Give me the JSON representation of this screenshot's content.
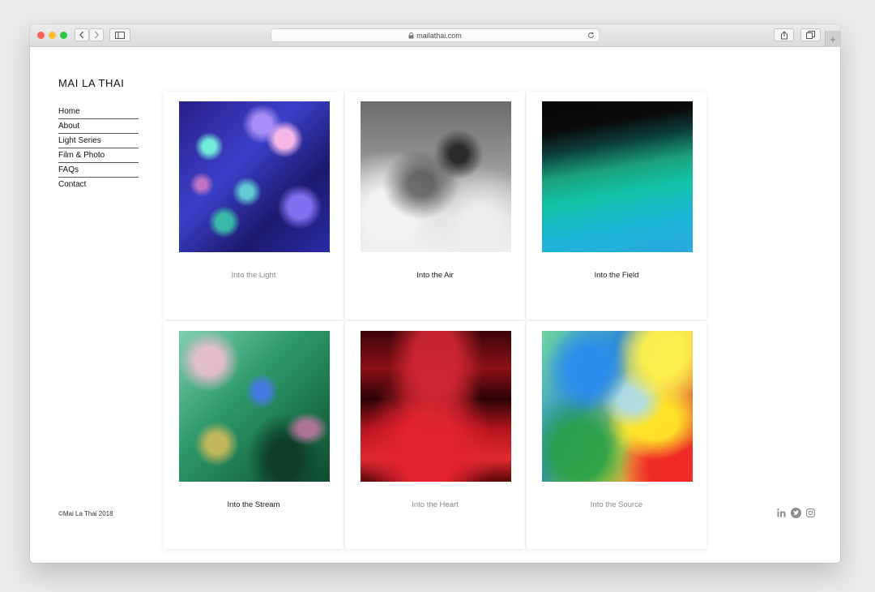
{
  "browser": {
    "url": "mailathai.com",
    "plus_label": "+",
    "lock_glyph": "🔒"
  },
  "site": {
    "title": "MAI LA THAI",
    "copyright": "©Mai La Thai 2018"
  },
  "nav": {
    "items": [
      "Home",
      "About",
      "Light Series",
      "Film & Photo",
      "FAQs",
      "Contact"
    ]
  },
  "gallery": {
    "items": [
      {
        "caption": "Into the Light",
        "image": "blue-purple-bokeh"
      },
      {
        "caption": "Into the Air",
        "image": "grey-smoke-abstract"
      },
      {
        "caption": "Into the Field",
        "image": "green-cyan-gradient"
      },
      {
        "caption": "Into the Stream",
        "image": "green-marble-fluid"
      },
      {
        "caption": "Into the Heart",
        "image": "red-black-blur"
      },
      {
        "caption": "Into the Source",
        "image": "rainbow-light-streaks"
      }
    ]
  },
  "social": [
    "linkedin-icon",
    "twitter-icon",
    "instagram-icon"
  ],
  "colors": {
    "close": "#fe5f57",
    "minimize": "#febc2e",
    "zoom": "#28c840",
    "social_icon": "#8c8c8c"
  }
}
